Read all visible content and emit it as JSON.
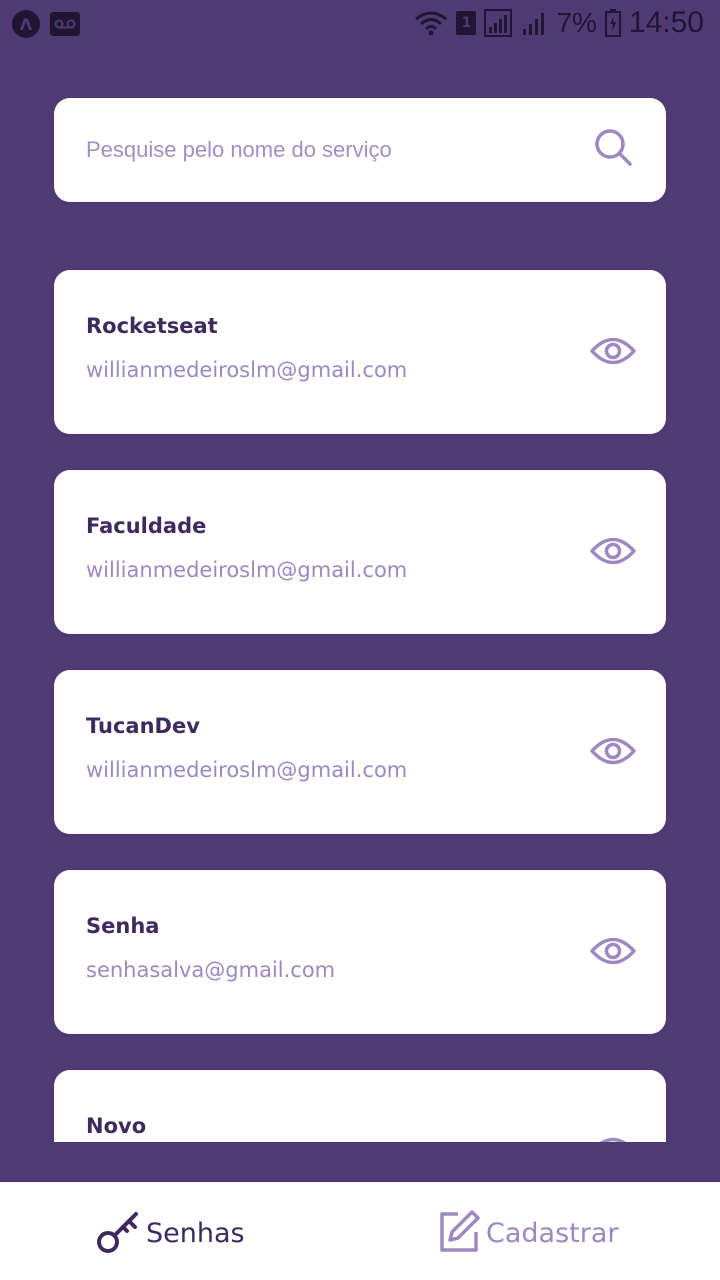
{
  "status_bar": {
    "left_badge": "Λ",
    "sim_label": "1",
    "battery_percent": "7%",
    "time": "14:50"
  },
  "search": {
    "placeholder": "Pesquise pelo nome do serviço",
    "value": ""
  },
  "passwords": [
    {
      "service": "Rocketseat",
      "email": "willianmedeiroslm@gmail.com"
    },
    {
      "service": "Faculdade",
      "email": "willianmedeiroslm@gmail.com"
    },
    {
      "service": "TucanDev",
      "email": "willianmedeiroslm@gmail.com"
    },
    {
      "service": "Senha",
      "email": "senhasalva@gmail.com"
    },
    {
      "service": "Novo",
      "email": ""
    }
  ],
  "nav": {
    "senhas_label": "Senhas",
    "cadastrar_label": "Cadastrar"
  },
  "colors": {
    "background": "#4f3a74",
    "primary_dark": "#3d2b5e",
    "accent_light": "#9d88bf",
    "card": "#ffffff"
  }
}
